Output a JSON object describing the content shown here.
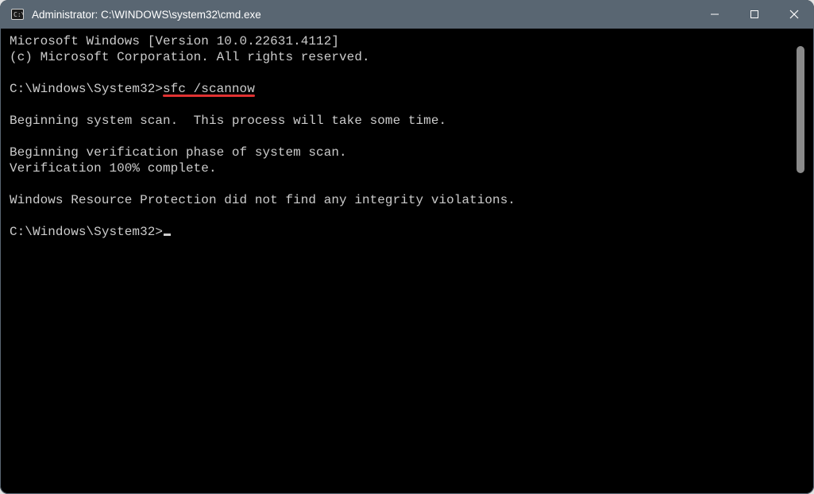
{
  "window": {
    "title": "Administrator: C:\\WINDOWS\\system32\\cmd.exe"
  },
  "terminal": {
    "lines": [
      "Microsoft Windows [Version 10.0.22631.4112]",
      "(c) Microsoft Corporation. All rights reserved.",
      "",
      "C:\\Windows\\System32>sfc /scannow",
      "",
      "Beginning system scan.  This process will take some time.",
      "",
      "Beginning verification phase of system scan.",
      "Verification 100% complete.",
      "",
      "Windows Resource Protection did not find any integrity violations.",
      "",
      "C:\\Windows\\System32>"
    ],
    "prompt1_path": "C:\\Windows\\System32>",
    "command": "sfc /scannow",
    "prompt2_path": "C:\\Windows\\System32>",
    "underline_target_line_index": 3
  },
  "colors": {
    "titlebar": "#596672",
    "underline": "#e03131",
    "text": "#cccccc"
  }
}
